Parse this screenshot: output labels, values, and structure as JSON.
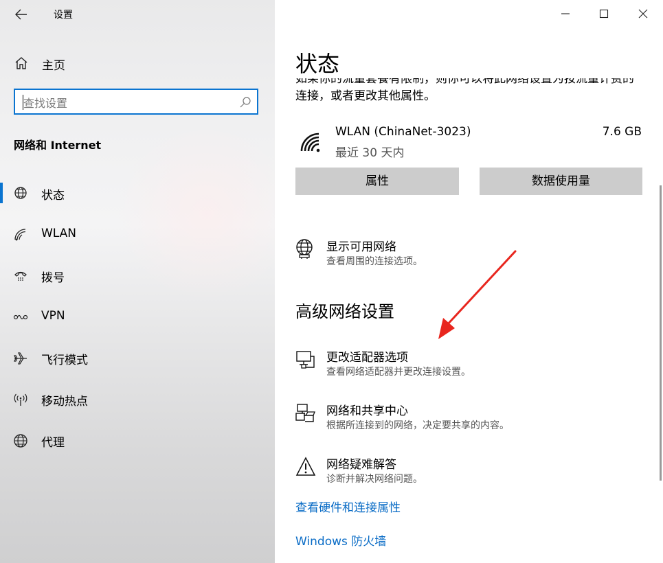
{
  "app": {
    "title": "设置"
  },
  "sidebar": {
    "home_label": "主页",
    "search_placeholder": "查找设置",
    "section_title": "网络和 Internet",
    "items": [
      {
        "label": "状态",
        "icon": "globe-status-icon",
        "active": true
      },
      {
        "label": "WLAN",
        "icon": "wifi-icon"
      },
      {
        "label": "拨号",
        "icon": "dialup-icon"
      },
      {
        "label": "VPN",
        "icon": "vpn-icon"
      },
      {
        "label": "飞行模式",
        "icon": "airplane-icon"
      },
      {
        "label": "移动热点",
        "icon": "hotspot-icon"
      },
      {
        "label": "代理",
        "icon": "globe-icon"
      }
    ]
  },
  "main": {
    "title": "状态",
    "intro_line1": "如果你的流量套餐有限制，则你可以将此网络设置为按流量计费的",
    "intro_line2": "连接，或者更改其他属性。",
    "connection": {
      "name": "WLAN (ChinaNet-3023)",
      "period": "最近 30 天内",
      "usage": "7.6 GB"
    },
    "buttons": {
      "properties": "属性",
      "data_usage": "数据使用量"
    },
    "show_networks": {
      "title": "显示可用网络",
      "subtitle": "查看周围的连接选项。"
    },
    "advanced": {
      "heading": "高级网络设置",
      "options": [
        {
          "title": "更改适配器选项",
          "subtitle": "查看网络适配器并更改连接设置。"
        },
        {
          "title": "网络和共享中心",
          "subtitle": "根据所连接到的网络，决定要共享的内容。"
        },
        {
          "title": "网络疑难解答",
          "subtitle": "诊断并解决网络问题。"
        }
      ]
    },
    "links": {
      "hardware": "查看硬件和连接属性",
      "firewall": "Windows 防火墙"
    }
  },
  "colors": {
    "accent": "#0a74d0",
    "link": "#0a6cc6",
    "button_bg": "#cccccc",
    "annotation_arrow": "#e8261e"
  }
}
